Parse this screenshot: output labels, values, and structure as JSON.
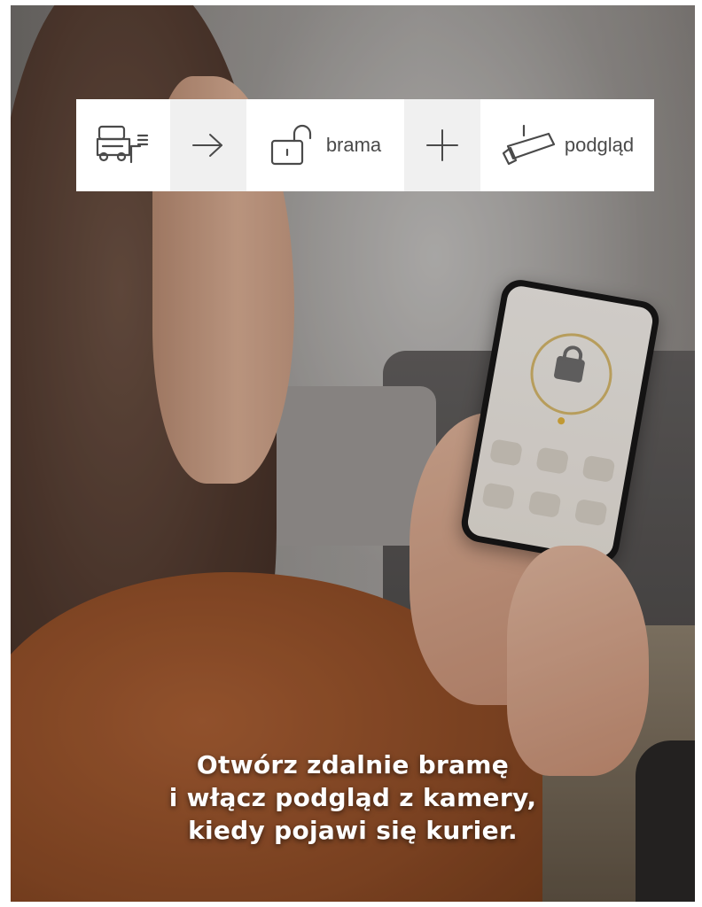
{
  "icon_bar": {
    "items": [
      {
        "icon": "delivery-truck-icon",
        "label": ""
      },
      {
        "icon": "arrow-right-icon",
        "label": ""
      },
      {
        "icon": "open-padlock-icon",
        "label": "brama"
      },
      {
        "icon": "plus-icon",
        "label": ""
      },
      {
        "icon": "security-camera-icon",
        "label": "podgląd"
      }
    ]
  },
  "caption": {
    "line1": "Otwórz zdalnie bramę",
    "line2": "i włącz podgląd z kamery,",
    "line3": "kiedy pojawi się kurier."
  },
  "colors": {
    "icon_stroke": "#4a4a4a",
    "separator_bg": "#f0f0f0",
    "caption_text": "#ffffff",
    "ring_accent": "#d7b96a"
  }
}
